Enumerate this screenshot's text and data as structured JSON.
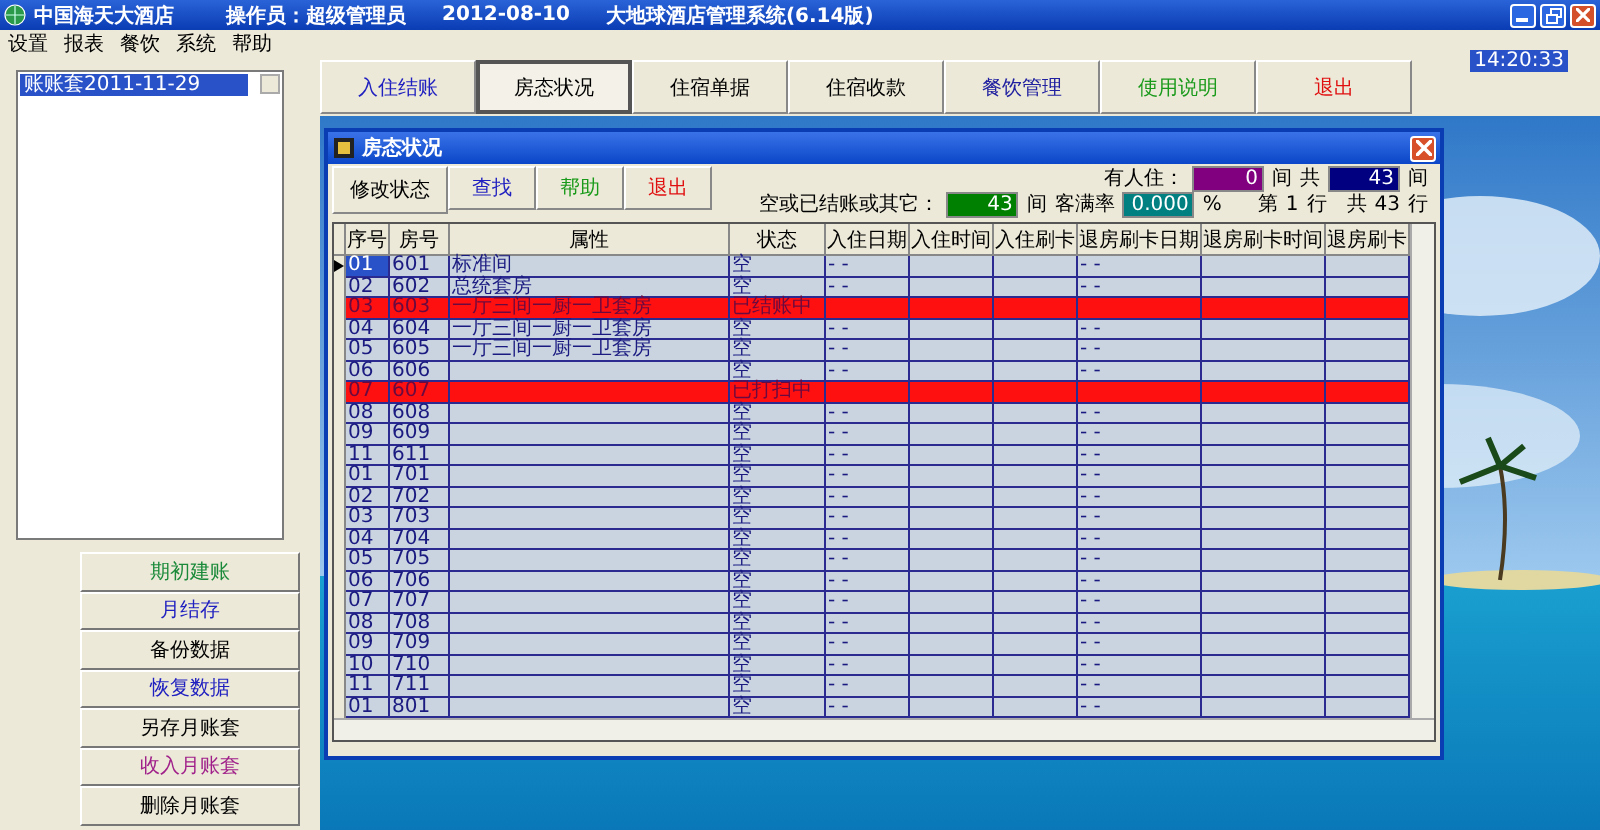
{
  "window": {
    "title_parts": [
      "中国海天大酒店",
      "操作员：超级管理员",
      "2012-08-10",
      "大地球酒店管理系统(6.14版)"
    ]
  },
  "menu": [
    "设置",
    "报表",
    "餐饮",
    "系统",
    "帮助"
  ],
  "account_list": {
    "items": [
      {
        "label": "账账套2011-11-29",
        "selected": true
      }
    ]
  },
  "side_buttons": [
    {
      "label": "期初建账",
      "color": "#1a8a3a"
    },
    {
      "label": "月结存",
      "color": "#2020c0"
    },
    {
      "label": "备份数据",
      "color": "#000000"
    },
    {
      "label": "恢复数据",
      "color": "#2020c0"
    },
    {
      "label": "另存月账套",
      "color": "#000000"
    },
    {
      "label": "收入月账套",
      "color": "#a0208a"
    },
    {
      "label": "删除月账套",
      "color": "#000000"
    }
  ],
  "nav_buttons": [
    {
      "label": "入住结账",
      "color": "#2020c0",
      "selected": false
    },
    {
      "label": "房态状况",
      "color": "#000000",
      "selected": true
    },
    {
      "label": "住宿单据",
      "color": "#000000",
      "selected": false
    },
    {
      "label": "住宿收款",
      "color": "#000000",
      "selected": false
    },
    {
      "label": "餐饮管理",
      "color": "#2020a0",
      "selected": false
    },
    {
      "label": "使用说明",
      "color": "#1a9a1a",
      "selected": false
    },
    {
      "label": "退出",
      "color": "#e01010",
      "selected": false
    }
  ],
  "clock": "14:20:33",
  "dialog": {
    "title": "房态状况",
    "toolbar": [
      {
        "label": "修改状态",
        "kind": "label",
        "color": "#000000"
      },
      {
        "label": "查找",
        "kind": "button",
        "color": "#2020c0"
      },
      {
        "label": "帮助",
        "kind": "button",
        "color": "#1a9a1a"
      },
      {
        "label": "退出",
        "kind": "button",
        "color": "#e01010"
      }
    ],
    "stats_line1": [
      {
        "label": "有人住：",
        "value": "0",
        "unit": "间",
        "color": "#800080"
      },
      {
        "label": "共",
        "value": "43",
        "unit": "间",
        "color": "#000080"
      }
    ],
    "stats_line2": [
      {
        "label": "空或已结账或其它：",
        "value": "43",
        "unit": "间",
        "color": "#008000"
      },
      {
        "label": "客满率",
        "value": "0.000",
        "unit": "%",
        "color": "#008080"
      }
    ],
    "position": {
      "prefix": "第",
      "row": "1",
      "row_unit": "行",
      "total_label": "共",
      "total": "43",
      "total_unit": "行"
    },
    "columns": [
      "序号",
      "房号",
      "属性",
      "状态",
      "入住日期",
      "入住时间",
      "入住刷卡",
      "退房刷卡日期",
      "退房刷卡时间",
      "退房刷卡"
    ],
    "rows": [
      {
        "no": "01",
        "room": "601",
        "type": "标准间",
        "status": "空",
        "checkin_date": "- -",
        "checkout_date": "- -",
        "selected": true,
        "highlighted": false
      },
      {
        "no": "02",
        "room": "602",
        "type": "总统套房",
        "status": "空",
        "checkin_date": "- -",
        "checkout_date": "- -",
        "selected": false,
        "highlighted": false
      },
      {
        "no": "03",
        "room": "603",
        "type": "一厅三间一厨一卫套房",
        "status": "已结账中",
        "selected": false,
        "highlighted": true
      },
      {
        "no": "04",
        "room": "604",
        "type": "一厅三间一厨一卫套房",
        "status": "空",
        "checkin_date": "- -",
        "checkout_date": "- -",
        "selected": false,
        "highlighted": false
      },
      {
        "no": "05",
        "room": "605",
        "type": "一厅三间一厨一卫套房",
        "status": "空",
        "checkin_date": "- -",
        "checkout_date": "- -",
        "selected": false,
        "highlighted": false
      },
      {
        "no": "06",
        "room": "606",
        "status": "空",
        "checkin_date": "- -",
        "checkout_date": "- -",
        "selected": false,
        "highlighted": false
      },
      {
        "no": "07",
        "room": "607",
        "status": "已打扫中",
        "selected": false,
        "highlighted": true
      },
      {
        "no": "08",
        "room": "608",
        "status": "空",
        "checkin_date": "- -",
        "checkout_date": "- -",
        "selected": false,
        "highlighted": false
      },
      {
        "no": "09",
        "room": "609",
        "status": "空",
        "checkin_date": "- -",
        "checkout_date": "- -",
        "selected": false,
        "highlighted": false
      },
      {
        "no": "11",
        "room": "611",
        "status": "空",
        "checkin_date": "- -",
        "checkout_date": "- -",
        "selected": false,
        "highlighted": false
      },
      {
        "no": "01",
        "room": "701",
        "status": "空",
        "checkin_date": "- -",
        "checkout_date": "- -",
        "selected": false,
        "highlighted": false
      },
      {
        "no": "02",
        "room": "702",
        "status": "空",
        "checkin_date": "- -",
        "checkout_date": "- -",
        "selected": false,
        "highlighted": false
      },
      {
        "no": "03",
        "room": "703",
        "status": "空",
        "checkin_date": "- -",
        "checkout_date": "- -",
        "selected": false,
        "highlighted": false
      },
      {
        "no": "04",
        "room": "704",
        "status": "空",
        "checkin_date": "- -",
        "checkout_date": "- -",
        "selected": false,
        "highlighted": false
      },
      {
        "no": "05",
        "room": "705",
        "status": "空",
        "checkin_date": "- -",
        "checkout_date": "- -",
        "selected": false,
        "highlighted": false
      },
      {
        "no": "06",
        "room": "706",
        "status": "空",
        "checkin_date": "- -",
        "checkout_date": "- -",
        "selected": false,
        "highlighted": false
      },
      {
        "no": "07",
        "room": "707",
        "status": "空",
        "checkin_date": "- -",
        "checkout_date": "- -",
        "selected": false,
        "highlighted": false
      },
      {
        "no": "08",
        "room": "708",
        "status": "空",
        "checkin_date": "- -",
        "checkout_date": "- -",
        "selected": false,
        "highlighted": false
      },
      {
        "no": "09",
        "room": "709",
        "status": "空",
        "checkin_date": "- -",
        "checkout_date": "- -",
        "selected": false,
        "highlighted": false
      },
      {
        "no": "10",
        "room": "710",
        "status": "空",
        "checkin_date": "- -",
        "checkout_date": "- -",
        "selected": false,
        "highlighted": false
      },
      {
        "no": "11",
        "room": "711",
        "status": "空",
        "checkin_date": "- -",
        "checkout_date": "- -",
        "selected": false,
        "highlighted": false
      },
      {
        "no": "01",
        "room": "801",
        "status": "空",
        "checkin_date": "- -",
        "checkout_date": "- -",
        "selected": false,
        "highlighted": false
      }
    ]
  }
}
